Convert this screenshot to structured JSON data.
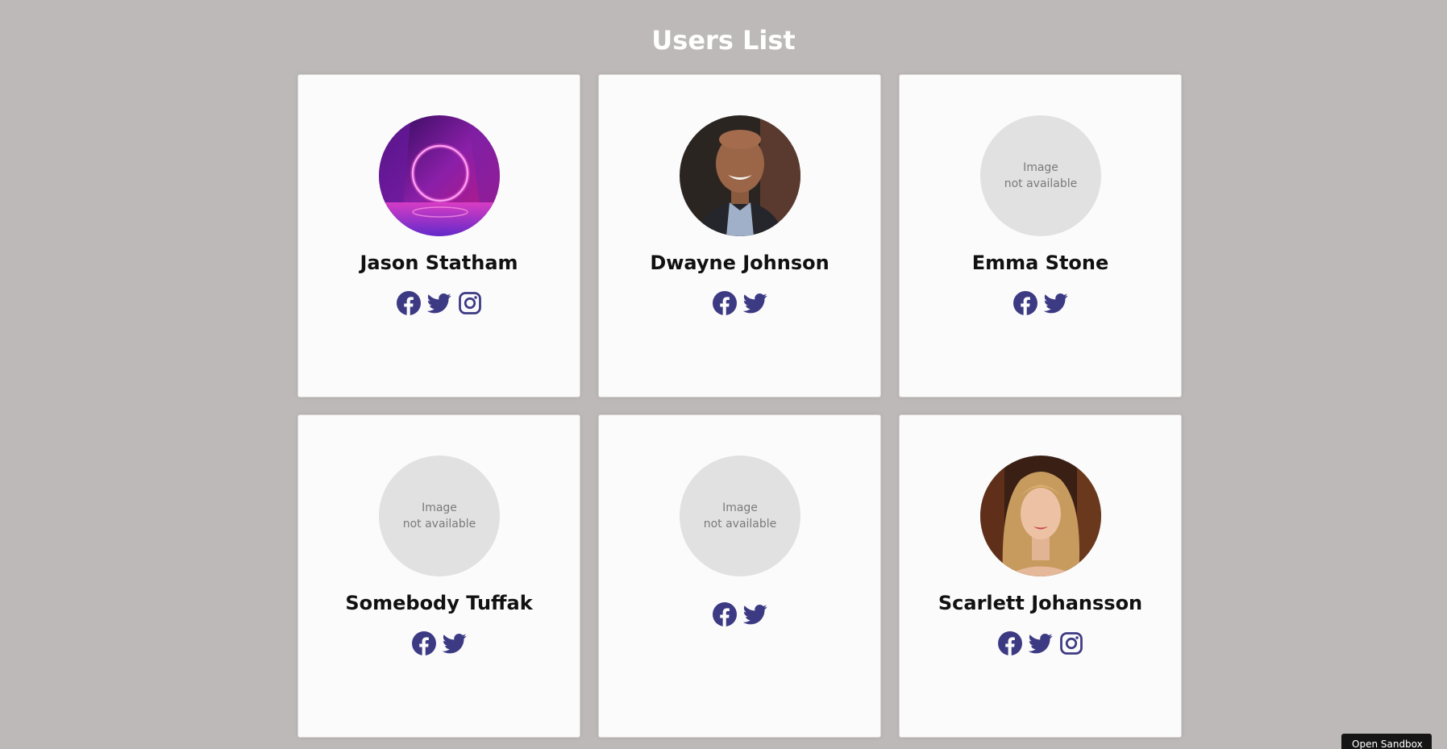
{
  "page": {
    "title": "Users List"
  },
  "colors": {
    "background": "#bdb9b8",
    "card": "#fbfbfb",
    "icon": "#3d3a84",
    "placeholder": "#e1e1e1"
  },
  "users": [
    {
      "name": "Jason Statham",
      "avatar": "neon-ring-image",
      "placeholder": "",
      "socials": [
        "facebook-icon",
        "twitter-icon",
        "instagram-icon"
      ]
    },
    {
      "name": "Dwayne Johnson",
      "avatar": "portrait-photo",
      "placeholder": "",
      "socials": [
        "facebook-icon",
        "twitter-icon"
      ]
    },
    {
      "name": "Emma Stone",
      "avatar": "",
      "placeholder": "Image\nnot available",
      "socials": [
        "facebook-icon",
        "twitter-icon"
      ]
    },
    {
      "name": "Somebody Tuffak",
      "avatar": "",
      "placeholder": "Image\nnot available",
      "socials": [
        "facebook-icon",
        "twitter-icon"
      ]
    },
    {
      "name": "",
      "avatar": "",
      "placeholder": "Image\nnot available",
      "socials": [
        "facebook-icon",
        "twitter-icon"
      ]
    },
    {
      "name": "Scarlett Johansson",
      "avatar": "portrait-photo",
      "placeholder": "",
      "socials": [
        "facebook-icon",
        "twitter-icon",
        "instagram-icon"
      ]
    }
  ],
  "footer": {
    "open_sandbox_label": "Open Sandbox"
  }
}
